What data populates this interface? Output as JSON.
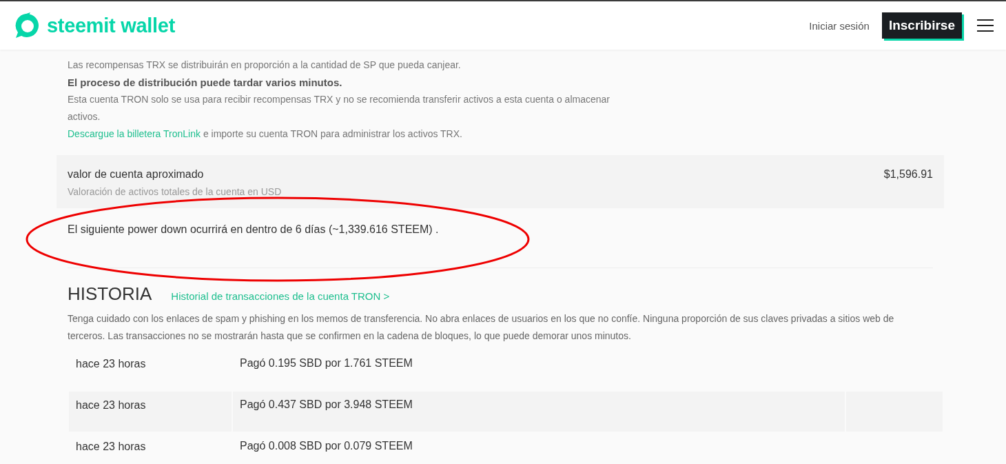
{
  "header": {
    "logo_text": "steemit wallet",
    "login": "Iniciar sesión",
    "signup": "Inscribirse"
  },
  "tron_info": {
    "lines": [
      {
        "kind": "plain",
        "text": "Las recompensas TRX se distribuirán en proporción a la cantidad de SP que pueda canjear."
      },
      {
        "kind": "bold",
        "text": "El proceso de distribución puede tardar varios minutos."
      },
      {
        "kind": "plain",
        "text": "Esta cuenta TRON solo se usa para recibir recompensas TRX y no se recomienda transferir activos a esta cuenta o almacenar activos."
      }
    ],
    "link": "Descargue la billetera TronLink",
    "link_suffix": " e importe su cuenta TRON para administrar los activos TRX."
  },
  "account_value": {
    "label": "valor de cuenta aproximado",
    "description": "Valoración de activos totales de la cuenta en USD",
    "value": "$1,596.91"
  },
  "power_down": "El siguiente power down ocurrirá en dentro de 6 días (~1,339.616 STEEM) .",
  "history": {
    "title": "HISTORIA",
    "tron_link": "Historial de transacciones de la cuenta TRON >",
    "warning": "Tenga cuidado con los enlaces de spam y phishing en los memos de transferencia. No abra enlaces de usuarios en los que no confíe. Ninguna proporción de sus claves privadas a sitios web de terceros.  Las transacciones no se mostrarán hasta que se confirmen en la cadena de bloques, lo que puede demorar unos minutos.",
    "rows": [
      {
        "time": "hace 23 horas",
        "description": "Pagó 0.195 SBD por 1.761 STEEM"
      },
      {
        "time": "hace 23 horas",
        "description": "Pagó 0.437 SBD por 3.948 STEEM"
      },
      {
        "time": "hace 23 horas",
        "description": "Pagó 0.008 SBD por 0.079 STEEM"
      }
    ]
  }
}
